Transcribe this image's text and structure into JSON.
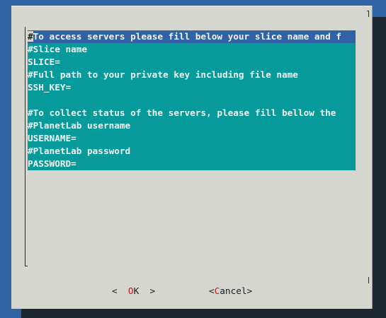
{
  "dialog": {
    "lines": [
      "#To access servers please fill below your slice name and f",
      "#Slice name",
      "SLICE=",
      "#Full path to your private key including file name",
      "SSH_KEY=",
      "",
      "#To collect status of the servers, please fill bellow the",
      "#PlanetLab username",
      "USERNAME=",
      "#PlanetLab password",
      "PASSWORD="
    ],
    "first_line_cursor_char": "#",
    "first_line_rest": "To access servers please fill below your slice name and f"
  },
  "buttons": {
    "ok": {
      "left": "<  ",
      "hot": "O",
      "rest": "K",
      "right": "  >"
    },
    "cancel": {
      "left": "<",
      "hot": "C",
      "rest": "ancel",
      "right": ">"
    }
  }
}
